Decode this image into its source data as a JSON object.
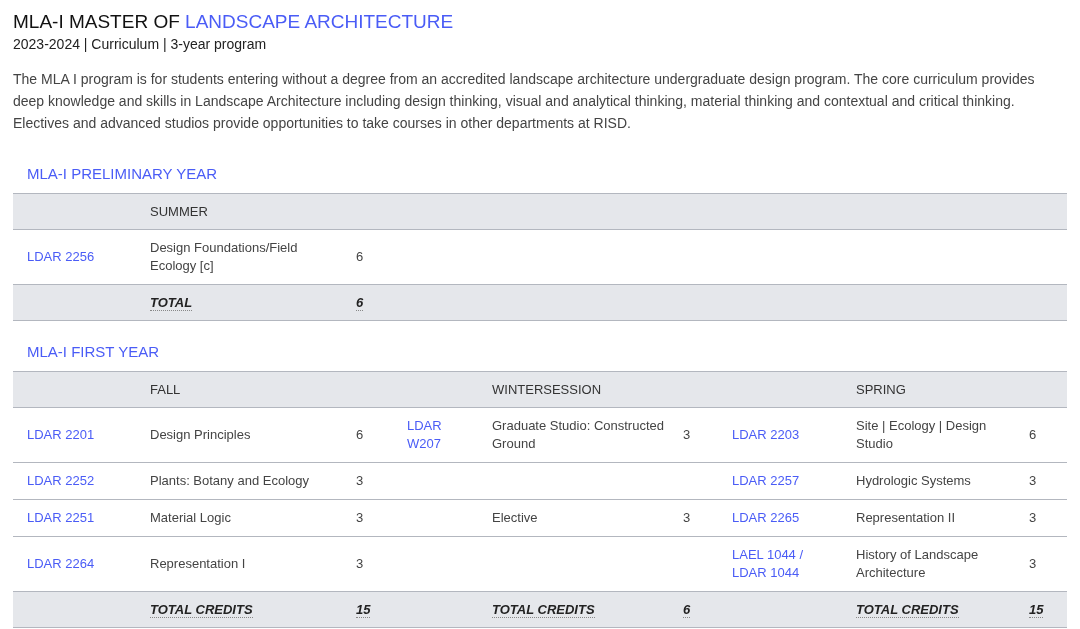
{
  "title": {
    "prefix": "MLA-I MASTER OF",
    "highlight": "LANDSCAPE ARCHITECTURE"
  },
  "subtitle": "2023-2024 | Curriculum | 3-year program",
  "description": "The MLA I program is for students entering without a degree from an accredited landscape architecture undergraduate design program. The core curriculum provides deep knowledge and skills in Landscape Architecture including design thinking, visual and analytical thinking, material thinking and contextual and critical thinking. Electives and advanced studios provide opportunities to take courses in other departments at RISD.",
  "sections": [
    {
      "heading": "MLA-I PRELIMINARY YEAR",
      "terms": [
        {
          "label": "SUMMER",
          "total_label": "TOTAL",
          "total": "6",
          "courses": [
            {
              "code": "LDAR 2256",
              "title": "Design Foundations/Field Ecology [c]",
              "credits": "6"
            }
          ]
        }
      ]
    },
    {
      "heading": "MLA-I FIRST YEAR",
      "terms": [
        {
          "label": "FALL",
          "total_label": "TOTAL CREDITS",
          "total": "15",
          "courses": [
            {
              "code": "LDAR 2201",
              "title": "Design Principles",
              "credits": "6"
            },
            {
              "code": "LDAR 2252",
              "title": "Plants: Botany and Ecology",
              "credits": "3"
            },
            {
              "code": "LDAR 2251",
              "title": "Material Logic",
              "credits": "3"
            },
            {
              "code": "LDAR 2264",
              "title": "Representation I",
              "credits": "3"
            }
          ]
        },
        {
          "label": "WINTERSESSION",
          "total_label": "TOTAL CREDITS",
          "total": "6",
          "courses": [
            {
              "kind": "course",
              "code": "LDAR W207",
              "title": "Graduate Studio: Constructed Ground",
              "credits": "3"
            },
            {
              "kind": "blank"
            },
            {
              "kind": "course",
              "title": "Elective",
              "credits": "3"
            },
            {
              "kind": "blank"
            }
          ]
        },
        {
          "label": "SPRING",
          "total_label": "TOTAL CREDITS",
          "total": "15",
          "courses": [
            {
              "code": "LDAR 2203",
              "title": "Site | Ecology | Design Studio",
              "credits": "6"
            },
            {
              "code": "LDAR 2257",
              "title": "Hydrologic Systems",
              "credits": "3"
            },
            {
              "code": "LDAR 2265",
              "title": "Representation II",
              "credits": "3"
            },
            {
              "code": "LAEL 1044 / LDAR 1044",
              "title": "History of Landscape Architecture",
              "credits": "3"
            }
          ]
        }
      ]
    }
  ]
}
